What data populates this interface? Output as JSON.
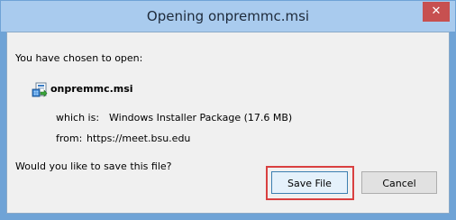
{
  "window": {
    "title": "Opening onpremmc.msi",
    "close_glyph": "✕"
  },
  "dialog": {
    "intro": "You have chosen to open:",
    "file_name": "onpremmc.msi",
    "which_is_label": "which is:",
    "which_is_value": "Windows Installer Package (17.6 MB)",
    "from_label": "from:",
    "from_value": "https://meet.bsu.edu",
    "question": "Would you like to save this file?",
    "file_icon": "msi-installer-icon"
  },
  "buttons": {
    "save_label": "Save File",
    "cancel_label": "Cancel"
  },
  "colors": {
    "titlebar": "#a9cbee",
    "close": "#c75050",
    "highlight": "#d94040",
    "body": "#f0f0f0"
  }
}
